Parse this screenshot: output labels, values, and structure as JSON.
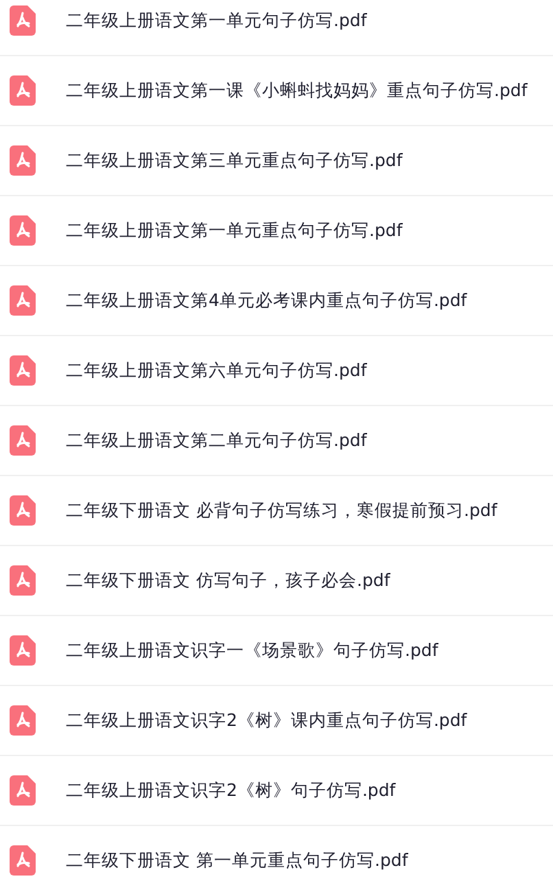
{
  "files": [
    {
      "name": "二年级上册语文第一单元句子仿写.pdf"
    },
    {
      "name": "二年级上册语文第一课《小蝌蚪找妈妈》重点句子仿写.pdf"
    },
    {
      "name": "二年级上册语文第三单元重点句子仿写.pdf"
    },
    {
      "name": "二年级上册语文第一单元重点句子仿写.pdf"
    },
    {
      "name": "二年级上册语文第4单元必考课内重点句子仿写.pdf"
    },
    {
      "name": "二年级上册语文第六单元句子仿写.pdf"
    },
    {
      "name": "二年级上册语文第二单元句子仿写.pdf"
    },
    {
      "name": "二年级下册语文 必背句子仿写练习，寒假提前预习.pdf"
    },
    {
      "name": "二年级下册语文 仿写句子，孩子必会.pdf"
    },
    {
      "name": "二年级上册语文识字一《场景歌》句子仿写.pdf"
    },
    {
      "name": "二年级上册语文识字2《树》课内重点句子仿写.pdf"
    },
    {
      "name": "二年级上册语文识字2《树》句子仿写.pdf"
    },
    {
      "name": "二年级下册语文 第一单元重点句子仿写.pdf"
    }
  ]
}
